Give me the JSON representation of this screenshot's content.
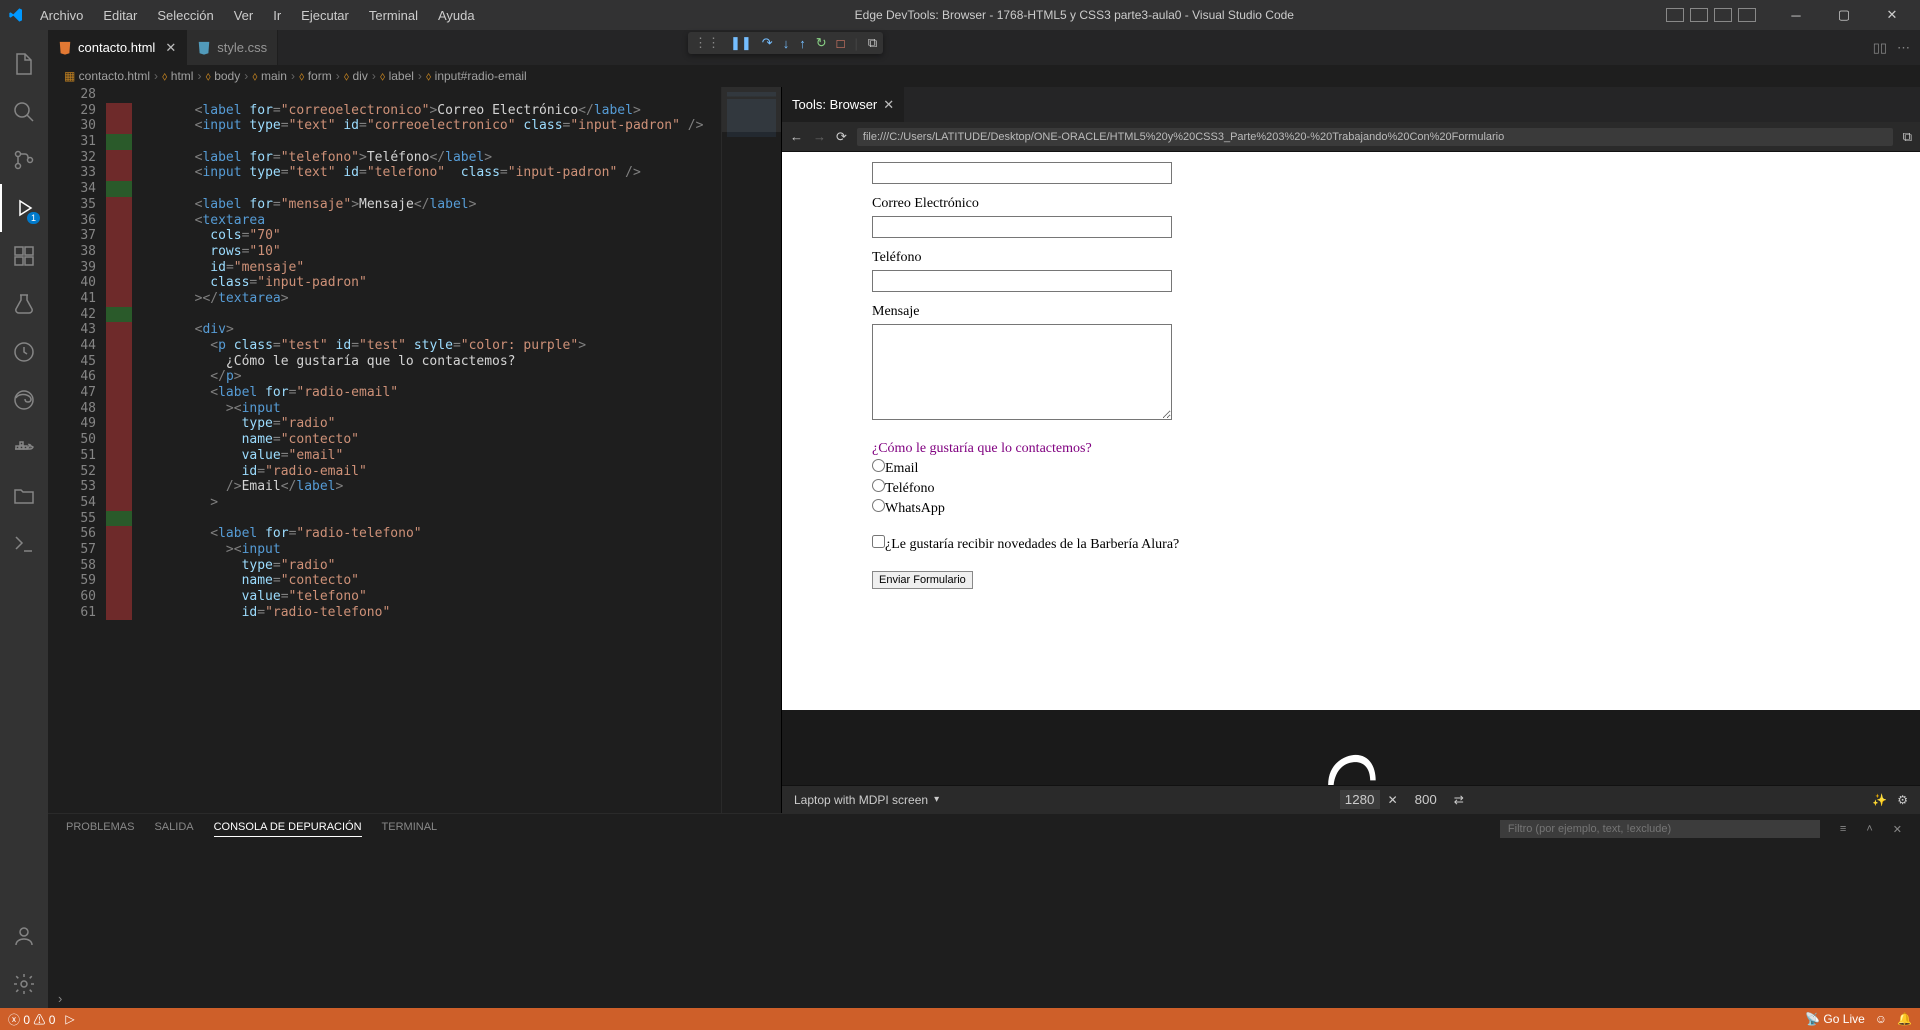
{
  "titlebar": {
    "menus": [
      "Archivo",
      "Editar",
      "Selección",
      "Ver",
      "Ir",
      "Ejecutar",
      "Terminal",
      "Ayuda"
    ],
    "title": "Edge DevTools: Browser - 1768-HTML5 y CSS3 parte3-aula0 - Visual Studio Code"
  },
  "tabs": [
    {
      "label": "contacto.html",
      "active": true,
      "icon": "html"
    },
    {
      "label": "style.css",
      "active": false,
      "icon": "css"
    }
  ],
  "devtools_tab": "Tools: Browser",
  "breadcrumb": [
    "contacto.html",
    "html",
    "body",
    "main",
    "form",
    "div",
    "label",
    "input#radio-email"
  ],
  "activity_badge": "1",
  "url": "file:///C:/Users/LATITUDE/Desktop/ONE-ORACLE/HTML5%20y%20CSS3_Parte%203%20-%20Trabajando%20Con%20Formulario",
  "form": {
    "label_correo": "Correo Electrónico",
    "label_tel": "Teléfono",
    "label_msg": "Mensaje",
    "contact_q": "¿Cómo le gustaría que lo contactemos?",
    "opt_email": "Email",
    "opt_tel": "Teléfono",
    "opt_wa": "WhatsApp",
    "newsletter": "¿Le gustaría recibir novedades de la Barbería Alura?",
    "submit": "Enviar Formulario"
  },
  "dev_footer": {
    "device": "Laptop with MDPI screen",
    "w": "1280",
    "h": "800"
  },
  "panel": {
    "tabs": [
      "PROBLEMAS",
      "SALIDA",
      "CONSOLA DE DEPURACIÓN",
      "TERMINAL"
    ],
    "active": 2,
    "filter_placeholder": "Filtro (por ejemplo, text, !exclude)"
  },
  "status": {
    "errors": "0",
    "warnings": "0",
    "golive": "Go Live"
  },
  "code": {
    "first_line": 28,
    "lines": [
      {
        "html": "",
        "g": ""
      },
      {
        "html": "        <span class=tag>&lt;</span><span class=el>label</span> <span class=attr>for</span><span class=tag>=</span><span class=str>\"correoelectronico\"</span><span class=tag>&gt;</span><span class=txt>Correo Electrónico</span><span class=tag>&lt;/</span><span class=el>label</span><span class=tag>&gt;</span>",
        "g": "r"
      },
      {
        "html": "        <span class=tag>&lt;</span><span class=el>input</span> <span class=attr>type</span><span class=tag>=</span><span class=str>\"text\"</span> <span class=attr>id</span><span class=tag>=</span><span class=str>\"correoelectronico\"</span> <span class=attr>class</span><span class=tag>=</span><span class=str>\"input-padron\"</span> <span class=tag>/&gt;</span>",
        "g": "r"
      },
      {
        "html": "",
        "g": "g"
      },
      {
        "html": "        <span class=tag>&lt;</span><span class=el>label</span> <span class=attr>for</span><span class=tag>=</span><span class=str>\"telefono\"</span><span class=tag>&gt;</span><span class=txt>Teléfono</span><span class=tag>&lt;/</span><span class=el>label</span><span class=tag>&gt;</span>",
        "g": "r"
      },
      {
        "html": "        <span class=tag>&lt;</span><span class=el>input</span> <span class=attr>type</span><span class=tag>=</span><span class=str>\"text\"</span> <span class=attr>id</span><span class=tag>=</span><span class=str>\"telefono\"</span>  <span class=attr>class</span><span class=tag>=</span><span class=str>\"input-padron\"</span> <span class=tag>/&gt;</span>",
        "g": "r"
      },
      {
        "html": "",
        "g": "g"
      },
      {
        "html": "        <span class=tag>&lt;</span><span class=el>label</span> <span class=attr>for</span><span class=tag>=</span><span class=str>\"mensaje\"</span><span class=tag>&gt;</span><span class=txt>Mensaje</span><span class=tag>&lt;/</span><span class=el>label</span><span class=tag>&gt;</span>",
        "g": "r"
      },
      {
        "html": "        <span class=tag>&lt;</span><span class=el>textarea</span>",
        "g": "r"
      },
      {
        "html": "          <span class=attr>cols</span><span class=tag>=</span><span class=str>\"70\"</span>",
        "g": "r"
      },
      {
        "html": "          <span class=attr>rows</span><span class=tag>=</span><span class=str>\"10\"</span>",
        "g": "r"
      },
      {
        "html": "          <span class=attr>id</span><span class=tag>=</span><span class=str>\"mensaje\"</span>",
        "g": "r"
      },
      {
        "html": "          <span class=attr>class</span><span class=tag>=</span><span class=str>\"input-padron\"</span>",
        "g": "r"
      },
      {
        "html": "        <span class=tag>&gt;&lt;/</span><span class=el>textarea</span><span class=tag>&gt;</span>",
        "g": "r"
      },
      {
        "html": "",
        "g": "g"
      },
      {
        "html": "        <span class=tag>&lt;</span><span class=el>div</span><span class=tag>&gt;</span>",
        "g": "r"
      },
      {
        "html": "          <span class=tag>&lt;</span><span class=el>p</span> <span class=attr>class</span><span class=tag>=</span><span class=str>\"test\"</span> <span class=attr>id</span><span class=tag>=</span><span class=str>\"test\"</span> <span class=attr>style</span><span class=tag>=</span><span class=str>\"color: purple\"</span><span class=tag>&gt;</span>",
        "g": "r"
      },
      {
        "html": "            <span class=txt>¿Cómo le gustaría que lo contactemos?</span>",
        "g": "r"
      },
      {
        "html": "          <span class=tag>&lt;/</span><span class=el>p</span><span class=tag>&gt;</span>",
        "g": "r"
      },
      {
        "html": "          <span class=tag>&lt;</span><span class=el>label</span> <span class=attr>for</span><span class=tag>=</span><span class=str>\"radio-email\"</span>",
        "g": "r"
      },
      {
        "html": "            <span class=tag>&gt;&lt;</span><span class=el>input</span>",
        "g": "r"
      },
      {
        "html": "              <span class=attr>type</span><span class=tag>=</span><span class=str>\"radio\"</span>",
        "g": "r"
      },
      {
        "html": "              <span class=attr>name</span><span class=tag>=</span><span class=str>\"contecto\"</span>",
        "g": "r"
      },
      {
        "html": "              <span class=attr>value</span><span class=tag>=</span><span class=str>\"email\"</span>",
        "g": "r"
      },
      {
        "html": "              <span class=attr>id</span><span class=tag>=</span><span class=str>\"radio-email\"</span>",
        "g": "r"
      },
      {
        "html": "            <span class=tag>/&gt;</span><span class=txt>Email</span><span class=tag>&lt;/</span><span class=el>label</span><span class=tag>&gt;</span>",
        "g": "r"
      },
      {
        "html": "          <span class=tag>&gt;</span>",
        "g": "r"
      },
      {
        "html": "",
        "g": "g"
      },
      {
        "html": "          <span class=tag>&lt;</span><span class=el>label</span> <span class=attr>for</span><span class=tag>=</span><span class=str>\"radio-telefono\"</span>",
        "g": "r"
      },
      {
        "html": "            <span class=tag>&gt;&lt;</span><span class=el>input</span>",
        "g": "r"
      },
      {
        "html": "              <span class=attr>type</span><span class=tag>=</span><span class=str>\"radio\"</span>",
        "g": "r"
      },
      {
        "html": "              <span class=attr>name</span><span class=tag>=</span><span class=str>\"contecto\"</span>",
        "g": "r"
      },
      {
        "html": "              <span class=attr>value</span><span class=tag>=</span><span class=str>\"telefono\"</span>",
        "g": "r"
      },
      {
        "html": "              <span class=attr>id</span><span class=tag>=</span><span class=str>\"radio-telefono\"</span>",
        "g": "r"
      }
    ]
  }
}
